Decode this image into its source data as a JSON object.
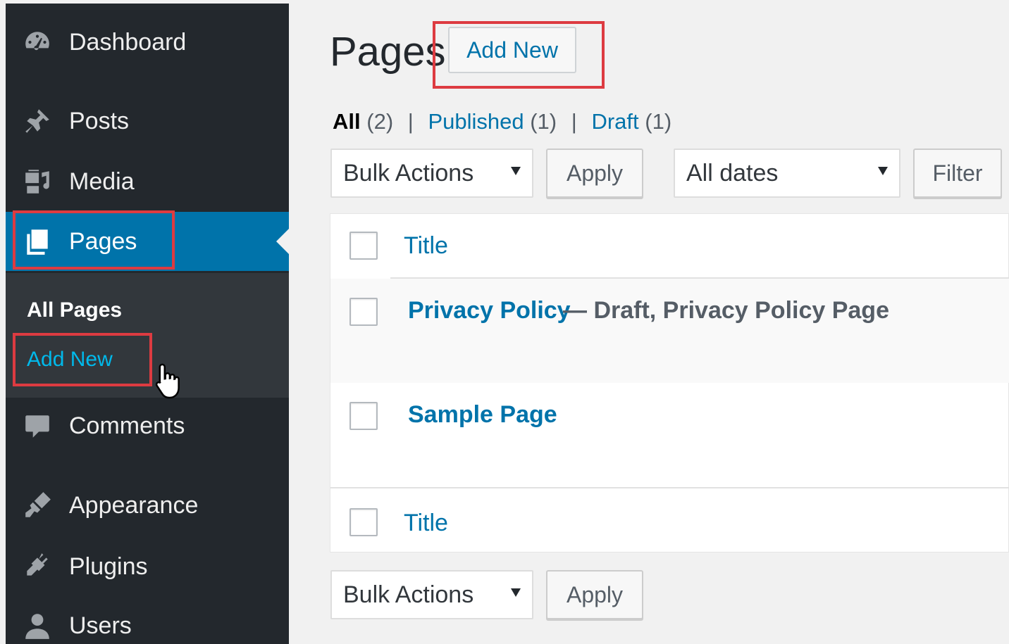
{
  "sidebar": {
    "items": [
      {
        "label": "Dashboard",
        "icon": "dashboard-icon"
      },
      {
        "label": "Posts",
        "icon": "pin-icon"
      },
      {
        "label": "Media",
        "icon": "media-icon"
      },
      {
        "label": "Pages",
        "icon": "pages-icon"
      },
      {
        "label": "Comments",
        "icon": "comment-icon"
      },
      {
        "label": "Appearance",
        "icon": "brush-icon"
      },
      {
        "label": "Plugins",
        "icon": "plugin-icon"
      },
      {
        "label": "Users",
        "icon": "user-icon"
      }
    ],
    "submenu": {
      "all_pages": "All Pages",
      "add_new": "Add New"
    }
  },
  "main": {
    "title": "Pages",
    "add_new_label": "Add New",
    "filters": {
      "all": "All",
      "all_count": "(2)",
      "published": "Published",
      "published_count": "(1)",
      "draft": "Draft",
      "draft_count": "(1)",
      "separator": "|"
    },
    "toolbar": {
      "bulk_actions": "Bulk Actions",
      "apply": "Apply",
      "all_dates": "All dates",
      "filter": "Filter"
    },
    "table": {
      "column_title": "Title",
      "rows": [
        {
          "title": "Privacy Policy",
          "state": "— Draft, Privacy Policy Page"
        },
        {
          "title": "Sample Page",
          "state": ""
        }
      ]
    }
  },
  "colors": {
    "sidebar_bg": "#23282d",
    "accent": "#0073aa",
    "highlight_box": "#dd3b41",
    "link_bright": "#00b9eb"
  }
}
